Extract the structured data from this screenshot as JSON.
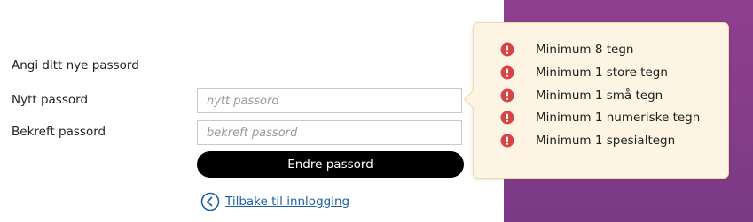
{
  "form": {
    "heading": "Angi ditt nye passord",
    "new_password_label": "Nytt passord",
    "new_password_placeholder": "nytt passord",
    "new_password_value": "",
    "confirm_password_label": "Bekreft passord",
    "confirm_password_placeholder": "bekreft passord",
    "confirm_password_value": "",
    "submit_label": "Endre passord",
    "back_link_label": "Tilbake til innlogging",
    "back_icon": "chevron-left-circle-icon"
  },
  "requirements": {
    "status_icon": "error-icon",
    "items": [
      {
        "label": "Minimum 8 tegn"
      },
      {
        "label": "Minimum 1 store tegn"
      },
      {
        "label": "Minimum 1 små tegn"
      },
      {
        "label": "Minimum 1 numeriske tegn"
      },
      {
        "label": "Minimum 1 spesialtegn"
      }
    ]
  },
  "colors": {
    "background_panel": "#8a3f8c",
    "button": "#000000",
    "link": "#1f5fa8",
    "error": "#d64545",
    "tooltip_bg": "#fdf4e3"
  }
}
